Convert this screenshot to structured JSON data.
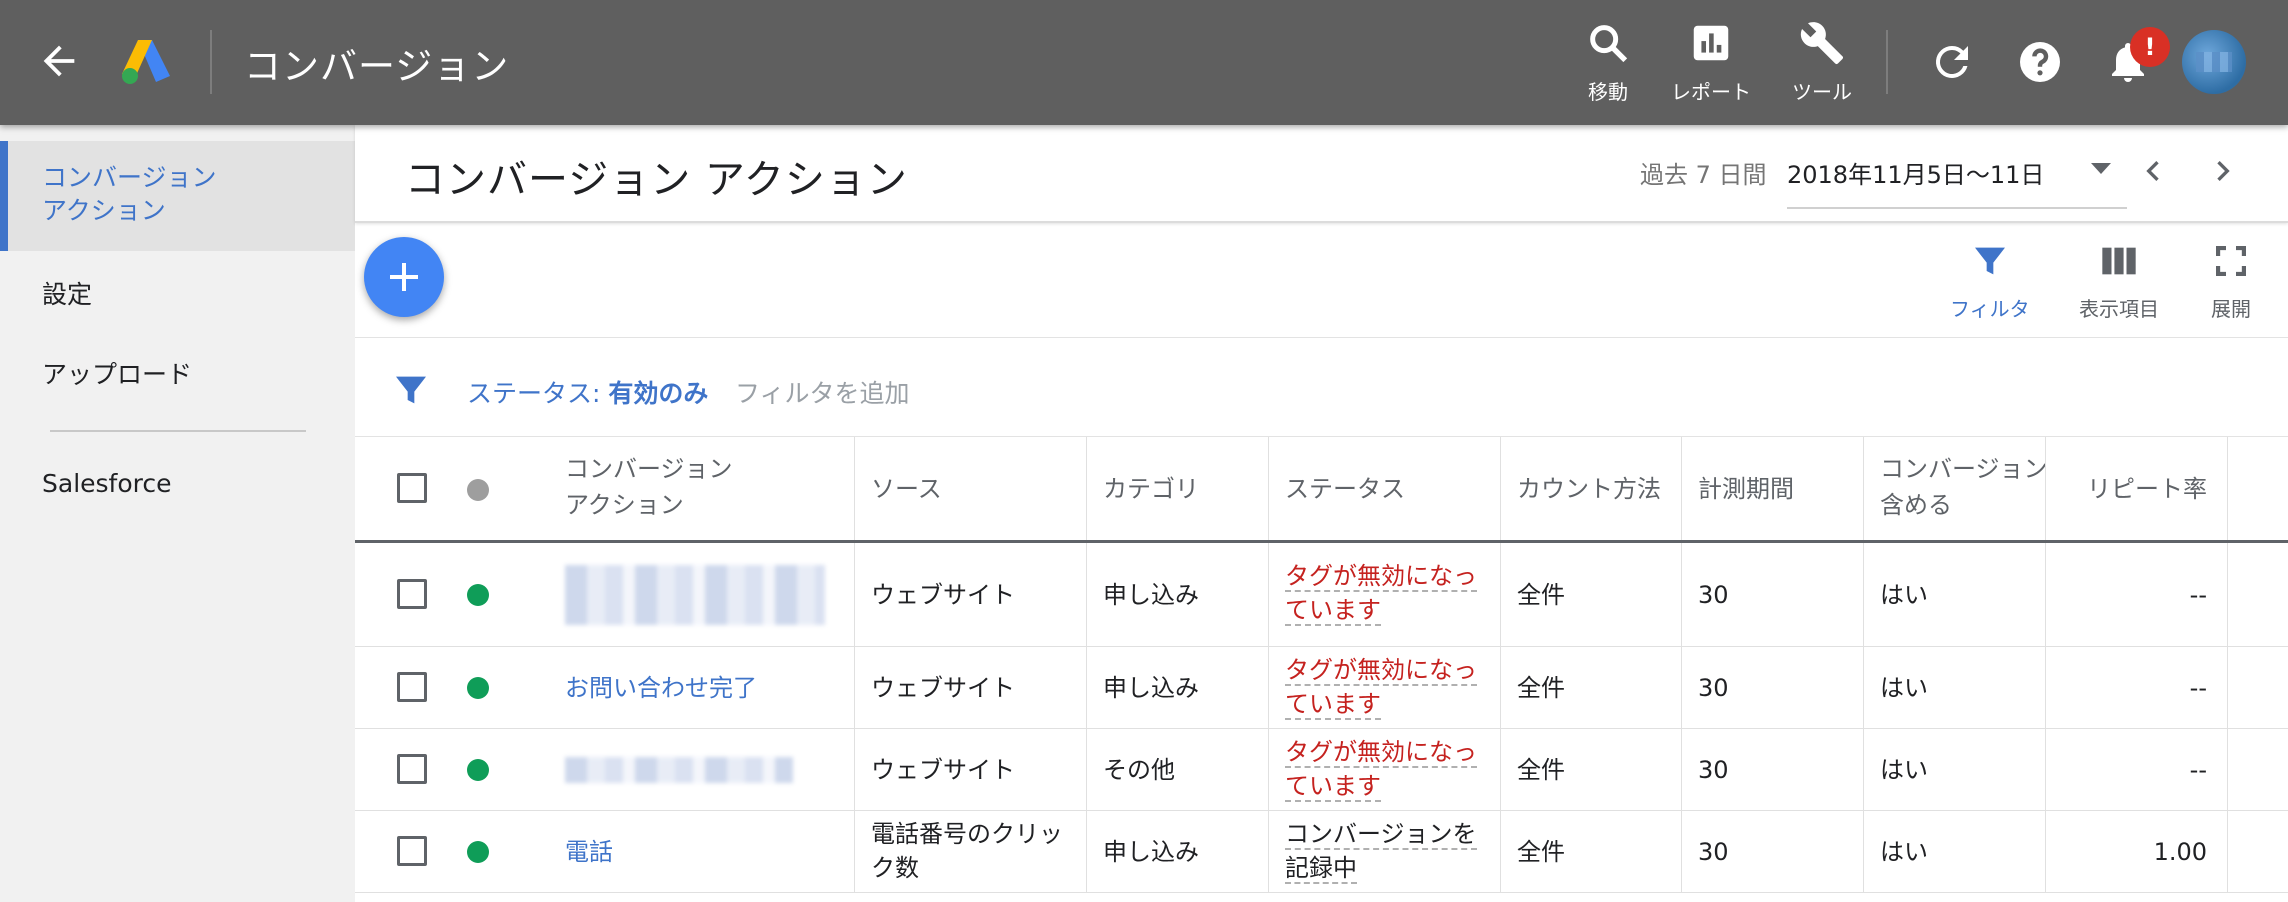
{
  "appbar": {
    "title": "コンバージョン",
    "tools": [
      {
        "label": "移動",
        "icon": "search-icon"
      },
      {
        "label": "レポート",
        "icon": "report-icon"
      },
      {
        "label": "ツール",
        "icon": "wrench-icon"
      }
    ],
    "notification_badge": "!",
    "colors": {
      "bar": "#5f5f5f",
      "accent": "#3f74c9",
      "badge": "#d93025",
      "fab": "#4285f4",
      "active_dot": "#0f9d58"
    }
  },
  "sidebar": {
    "items": [
      {
        "label_line1": "コンバージョン",
        "label_line2": "アクション",
        "active": true
      },
      {
        "label": "設定"
      },
      {
        "label": "アップロード"
      },
      {
        "label": "Salesforce"
      }
    ]
  },
  "header": {
    "title": "コンバージョン アクション",
    "range_label": "過去 7 日間",
    "range_value": "2018年11月5日〜11日"
  },
  "toolbar": {
    "filter_label": "フィルタ",
    "columns_label": "表示項目",
    "expand_label": "展開"
  },
  "filterbar": {
    "status_prefix": "ステータス:",
    "status_value": "有効のみ",
    "add_filter": "フィルタを追加"
  },
  "table": {
    "headers": {
      "action_line1": "コンバージョン",
      "action_line2": "アクション",
      "source": "ソース",
      "category": "カテゴリ",
      "status": "ステータス",
      "count": "カウント方法",
      "period": "計測期間",
      "include_line1": "コンバージョン",
      "include_line2": "含める",
      "repeat": "リピート率"
    },
    "rows": [
      {
        "action": "",
        "blurred": true,
        "source": "ウェブサイト",
        "category": "申し込み",
        "status_line1": "タグが無効になっ",
        "status_line2": "ています",
        "status_type": "bad",
        "count": "全件",
        "period": "30",
        "include": "はい",
        "repeat": "--"
      },
      {
        "action": "お問い合わせ完了",
        "blurred": false,
        "source": "ウェブサイト",
        "category": "申し込み",
        "status_line1": "タグが無効になっ",
        "status_line2": "ています",
        "status_type": "bad",
        "count": "全件",
        "period": "30",
        "include": "はい",
        "repeat": "--"
      },
      {
        "action": "",
        "blurred": true,
        "source": "ウェブサイト",
        "category": "その他",
        "status_line1": "タグが無効になっ",
        "status_line2": "ています",
        "status_type": "bad",
        "count": "全件",
        "period": "30",
        "include": "はい",
        "repeat": "--"
      },
      {
        "action": "電話",
        "blurred": false,
        "source_line1": "電話番号のクリッ",
        "source_line2": "ク数",
        "category": "申し込み",
        "status_line1": "コンバージョンを",
        "status_line2": "記録中",
        "status_type": "ok",
        "count": "全件",
        "period": "30",
        "include": "はい",
        "repeat": "1.00"
      }
    ]
  }
}
